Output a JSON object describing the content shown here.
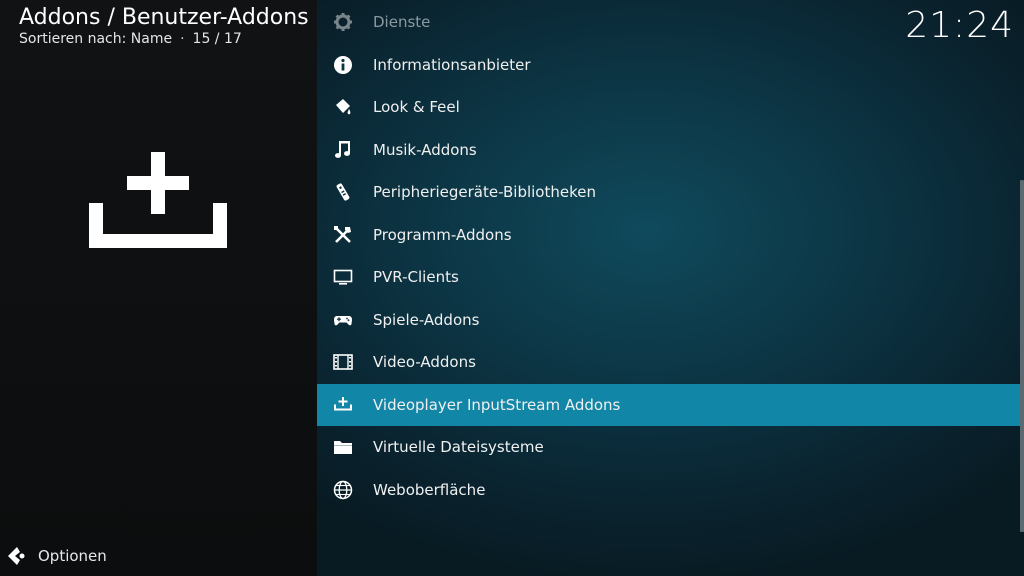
{
  "header": {
    "title": "Addons / Benutzer-Addons",
    "sort_label": "Sortieren nach: Name",
    "separator": "·",
    "position": "15 / 17"
  },
  "clock": "21:24",
  "footer": {
    "options_label": "Optionen"
  },
  "list": {
    "items": [
      {
        "label": "Dienste",
        "icon": "gear-icon"
      },
      {
        "label": "Informationsanbieter",
        "icon": "info-icon"
      },
      {
        "label": "Look & Feel",
        "icon": "paint-bucket-icon"
      },
      {
        "label": "Musik-Addons",
        "icon": "music-note-icon"
      },
      {
        "label": "Peripheriegeräte-Bibliotheken",
        "icon": "remote-control-icon"
      },
      {
        "label": "Programm-Addons",
        "icon": "tools-icon"
      },
      {
        "label": "PVR-Clients",
        "icon": "tv-icon"
      },
      {
        "label": "Spiele-Addons",
        "icon": "gamepad-icon"
      },
      {
        "label": "Video-Addons",
        "icon": "film-icon"
      },
      {
        "label": "Videoplayer InputStream Addons",
        "icon": "download-tray-icon",
        "selected": true
      },
      {
        "label": "Virtuelle Dateisysteme",
        "icon": "folder-icon"
      },
      {
        "label": "Weboberfläche",
        "icon": "globe-icon"
      }
    ]
  },
  "colors": {
    "accent": "#1286a6",
    "background_right": "#0c3443",
    "background_left": "#0f1113"
  }
}
